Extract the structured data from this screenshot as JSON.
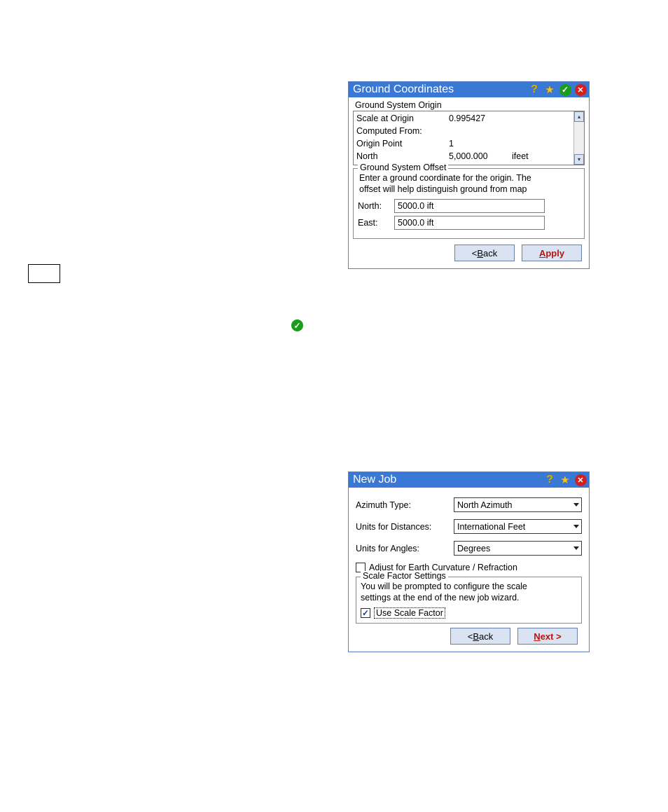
{
  "ground_window": {
    "title": "Ground Coordinates",
    "origin_header": "Ground System Origin",
    "rows": [
      {
        "label": "Scale at Origin",
        "value": "0.995427",
        "unit": ""
      },
      {
        "label": "Computed From:",
        "value": "",
        "unit": ""
      },
      {
        "label": "Origin Point",
        "value": "1",
        "unit": ""
      },
      {
        "label": "North",
        "value": "5,000.000",
        "unit": "ifeet"
      }
    ],
    "offset": {
      "legend": "Ground System Offset",
      "desc1": "Enter a ground coordinate for the origin. The",
      "desc2": "offset will help distinguish ground from map",
      "north_label": "North:",
      "north_value": "5000.0 ift",
      "east_label": "East:",
      "east_value": "5000.0 ift"
    },
    "back_prefix": "< ",
    "back_ul": "B",
    "back_suffix": "ack",
    "apply_ul": "A",
    "apply_suffix": "pply"
  },
  "newjob_window": {
    "title": "New Job",
    "az_label": "Azimuth Type:",
    "az_value": "North Azimuth",
    "dist_label": "Units for Distances:",
    "dist_value": "International Feet",
    "ang_label": "Units for Angles:",
    "ang_value": "Degrees",
    "adj_ul": "A",
    "adj_suffix": "djust for Earth Curvature / Refraction",
    "sf_legend": "Scale Factor Settings",
    "sf_desc1": "You will be prompted to configure the scale",
    "sf_desc2": "settings at the end of the new job wizard.",
    "use_sf_ul": "U",
    "use_sf_suffix": "se Scale Factor",
    "back_prefix": "< ",
    "back_ul": "B",
    "back_suffix": "ack",
    "next_ul": "N",
    "next_suffix": "ext  >"
  }
}
